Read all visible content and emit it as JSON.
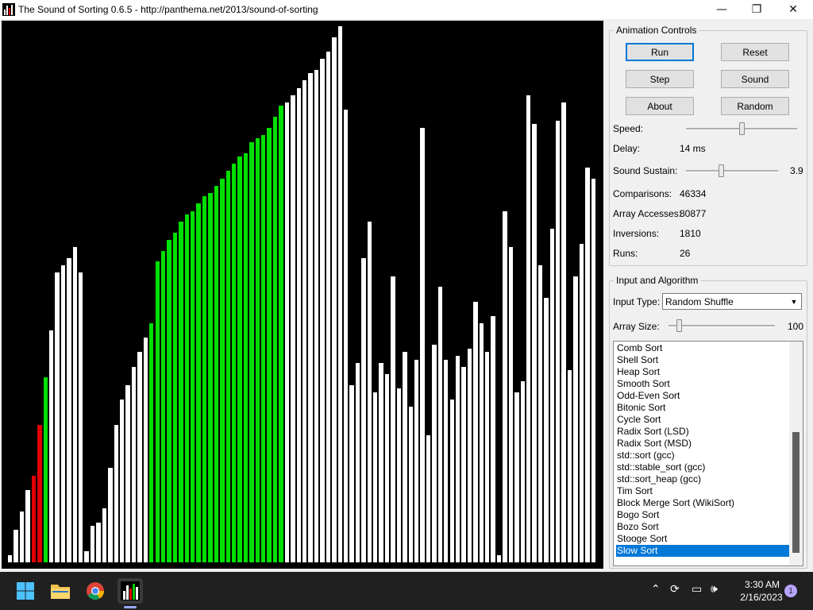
{
  "window": {
    "title": "The Sound of Sorting 0.6.5 - http://panthema.net/2013/sound-of-sorting",
    "minimize_glyph": "—",
    "maximize_glyph": "❐",
    "close_glyph": "✕"
  },
  "colors": {
    "bar_default": "#ffffff",
    "bar_highlight": "#00e000",
    "bar_active": "#e00000",
    "canvas_bg": "#000000",
    "selection": "#0078d7"
  },
  "bars": {
    "heights_relative": [
      2,
      9,
      14,
      20,
      24,
      38,
      51,
      64,
      80,
      82,
      84,
      87,
      80,
      3,
      10,
      11,
      15,
      26,
      38,
      45,
      49,
      54,
      58,
      62,
      66,
      83,
      86,
      89,
      91,
      94,
      96,
      97,
      99,
      101,
      102,
      104,
      106,
      108,
      110,
      112,
      113,
      116,
      117,
      118,
      120,
      123,
      126,
      127,
      129,
      131,
      133,
      135,
      136,
      139,
      141,
      145,
      148,
      125,
      49,
      55,
      84,
      94,
      47,
      55,
      52,
      79,
      48,
      58,
      43,
      56,
      120,
      35,
      60,
      76,
      56,
      45,
      57,
      54,
      59,
      72,
      66,
      58,
      68,
      2,
      97,
      87,
      47,
      50,
      129,
      121,
      82,
      73,
      92,
      122,
      127,
      53,
      79,
      88,
      109,
      106
    ],
    "colors_by_index": {
      "highlight": [
        6,
        24,
        25,
        26,
        27,
        28,
        29,
        30,
        31,
        32,
        33,
        34,
        35,
        36,
        37,
        38,
        39,
        40,
        41,
        42,
        43,
        44,
        45,
        46
      ],
      "active": [
        4,
        5
      ]
    }
  },
  "controls": {
    "animation_group_label": "Animation Controls",
    "run_label": "Run",
    "reset_label": "Reset",
    "step_label": "Step",
    "sound_label": "Sound",
    "about_label": "About",
    "random_label": "Random",
    "speed_label": "Speed:",
    "speed_level": 0.5,
    "delay_label": "Delay:",
    "delay_value": "14 ms",
    "sustain_label": "Sound Sustain:",
    "sustain_value": "3.9",
    "sustain_level": 0.38,
    "comparisons_label": "Comparisons:",
    "comparisons_value": "46334",
    "accesses_label": "Array Accesses:",
    "accesses_value": "80877",
    "inversions_label": "Inversions:",
    "inversions_value": "1810",
    "runs_label": "Runs:",
    "runs_value": "26"
  },
  "input": {
    "group_label": "Input and Algorithm",
    "input_type_label": "Input Type:",
    "input_type_value": "Random Shuffle",
    "array_size_label": "Array Size:",
    "array_size_value": "100",
    "array_size_level": 0.08
  },
  "algorithms": {
    "items": [
      "Comb Sort",
      "Shell Sort",
      "Heap Sort",
      "Smooth Sort",
      "Odd-Even Sort",
      "Bitonic Sort",
      "Cycle Sort",
      "Radix Sort (LSD)",
      "Radix Sort (MSD)",
      "std::sort (gcc)",
      "std::stable_sort (gcc)",
      "std::sort_heap (gcc)",
      "Tim Sort",
      "Block Merge Sort (WikiSort)",
      "Bogo Sort",
      "Bozo Sort",
      "Stooge Sort",
      "Slow Sort"
    ],
    "selected": "Slow Sort"
  },
  "taskbar": {
    "time": "3:30 AM",
    "date": "2/16/2023",
    "notification_count": "1",
    "icons": [
      "windows-start-icon",
      "file-explorer-icon",
      "chrome-icon",
      "sound-of-sorting-icon"
    ]
  }
}
